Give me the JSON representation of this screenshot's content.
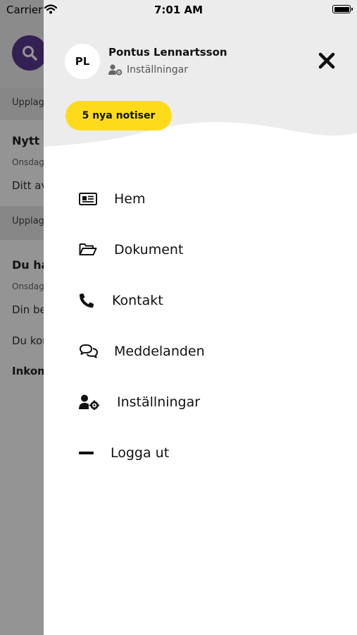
{
  "status_bar": {
    "carrier": "Carrier",
    "time": "7:01 AM"
  },
  "background": {
    "section_label_1": "Upplag",
    "item1_title": "Nytt",
    "item1_date": "Onsdag",
    "item1_body": "Ditt av",
    "section_label_2": "Upplag",
    "item2_title": "Du ha",
    "item2_date": "Onsdag",
    "item2_body": "Din be",
    "item2_body2": "Du kor",
    "item2_bold": "Inkom"
  },
  "drawer": {
    "avatar_initials": "PL",
    "user_name": "Pontus Lennartsson",
    "settings_link": "Inställningar",
    "notification_badge": "5 nya notiser",
    "menu": [
      {
        "label": "Hem",
        "icon": "newspaper-icon"
      },
      {
        "label": "Dokument",
        "icon": "folder-open-icon"
      },
      {
        "label": "Kontakt",
        "icon": "phone-icon"
      },
      {
        "label": "Meddelanden",
        "icon": "chat-bubbles-icon"
      },
      {
        "label": "Inställningar",
        "icon": "user-cog-icon"
      },
      {
        "label": "Logga ut",
        "icon": "minus-icon"
      }
    ]
  },
  "colors": {
    "accent_yellow": "#fddb1a",
    "search_purple": "#5a3a91",
    "header_gray": "#ececec"
  }
}
